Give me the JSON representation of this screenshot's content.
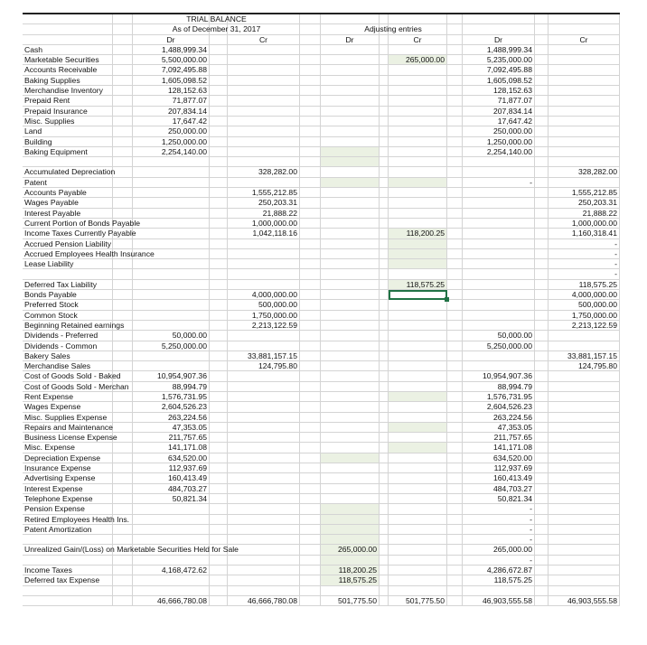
{
  "header": {
    "title": "TRIAL BALANCE",
    "subtitle": "As of December 31, 2017",
    "adjusting_label": "Adjusting entries",
    "dr": "Dr",
    "cr": "Cr"
  },
  "colors": {
    "highlight": "#ebf1e3",
    "selection": "#217346"
  },
  "rows": [
    [
      "Cash",
      "1,488,999.34",
      "",
      "",
      "",
      "1,488,999.34",
      ""
    ],
    [
      "Marketable Securities",
      "5,500,000.00",
      "",
      "",
      "265,000.00",
      "5,235,000.00",
      ""
    ],
    [
      "Accounts Receivable",
      "7,092,495.88",
      "",
      "",
      "",
      "7,092,495.88",
      ""
    ],
    [
      "Baking Supplies",
      "1,605,098.52",
      "",
      "",
      "",
      "1,605,098.52",
      ""
    ],
    [
      "Merchandise Inventory",
      "128,152.63",
      "",
      "",
      "",
      "128,152.63",
      ""
    ],
    [
      "Prepaid Rent",
      "71,877.07",
      "",
      "",
      "",
      "71,877.07",
      ""
    ],
    [
      "Prepaid Insurance",
      "207,834.14",
      "",
      "",
      "",
      "207,834.14",
      ""
    ],
    [
      "Misc. Supplies",
      "17,647.42",
      "",
      "",
      "",
      "17,647.42",
      ""
    ],
    [
      "Land",
      "250,000.00",
      "",
      "",
      "",
      "250,000.00",
      ""
    ],
    [
      "Building",
      "1,250,000.00",
      "",
      "",
      "",
      "1,250,000.00",
      ""
    ],
    [
      "Baking Equipment",
      "2,254,140.00",
      "",
      "",
      "",
      "2,254,140.00",
      ""
    ],
    [
      "",
      "",
      "",
      "",
      "",
      "",
      ""
    ],
    [
      "Accumulated Depreciation",
      "",
      "328,282.00",
      "",
      "",
      "",
      "328,282.00"
    ],
    [
      "Patent",
      "",
      "",
      "",
      "",
      "-",
      ""
    ],
    [
      "Accounts Payable",
      "",
      "1,555,212.85",
      "",
      "",
      "",
      "1,555,212.85"
    ],
    [
      "Wages Payable",
      "",
      "250,203.31",
      "",
      "",
      "",
      "250,203.31"
    ],
    [
      "Interest Payable",
      "",
      "21,888.22",
      "",
      "",
      "",
      "21,888.22"
    ],
    [
      "Current Portion of Bonds Payable",
      "",
      "1,000,000.00",
      "",
      "",
      "",
      "1,000,000.00"
    ],
    [
      "Income Taxes Currently Payable",
      "",
      "1,042,118.16",
      "",
      "118,200.25",
      "",
      "1,160,318.41"
    ],
    [
      "Accrued Pension Liability",
      "",
      "",
      "",
      "",
      "",
      "-"
    ],
    [
      "Accrued Employees Health Insurance",
      "",
      "",
      "",
      "",
      "",
      "-"
    ],
    [
      "Lease Liability",
      "",
      "",
      "",
      "",
      "",
      "-"
    ],
    [
      "",
      "",
      "",
      "",
      "",
      "",
      "-"
    ],
    [
      "Deferred Tax Liability",
      "",
      "",
      "",
      "118,575.25",
      "",
      "118,575.25"
    ],
    [
      "Bonds Payable",
      "",
      "4,000,000.00",
      "",
      "",
      "",
      "4,000,000.00"
    ],
    [
      "Preferred Stock",
      "",
      "500,000.00",
      "",
      "",
      "",
      "500,000.00"
    ],
    [
      "Common Stock",
      "",
      "1,750,000.00",
      "",
      "",
      "",
      "1,750,000.00"
    ],
    [
      "Beginning Retained earnings",
      "",
      "2,213,122.59",
      "",
      "",
      "",
      "2,213,122.59"
    ],
    [
      "Dividends - Preferred",
      "50,000.00",
      "",
      "",
      "",
      "50,000.00",
      ""
    ],
    [
      "Dividends - Common",
      "5,250,000.00",
      "",
      "",
      "",
      "5,250,000.00",
      ""
    ],
    [
      "Bakery Sales",
      "",
      "33,881,157.15",
      "",
      "",
      "",
      "33,881,157.15"
    ],
    [
      "Merchandise Sales",
      "",
      "124,795.80",
      "",
      "",
      "",
      "124,795.80"
    ],
    [
      "Cost of Goods Sold - Baked",
      "10,954,907.36",
      "",
      "",
      "",
      "10,954,907.36",
      ""
    ],
    [
      "Cost of Goods Sold - Merchan",
      "88,994.79",
      "",
      "",
      "",
      "88,994.79",
      ""
    ],
    [
      "Rent Expense",
      "1,576,731.95",
      "",
      "",
      "",
      "1,576,731.95",
      ""
    ],
    [
      "Wages Expense",
      "2,604,526.23",
      "",
      "",
      "",
      "2,604,526.23",
      ""
    ],
    [
      "Misc. Supplies Expense",
      "263,224.56",
      "",
      "",
      "",
      "263,224.56",
      ""
    ],
    [
      "Repairs and Maintenance",
      "47,353.05",
      "",
      "",
      "",
      "47,353.05",
      ""
    ],
    [
      "Business License Expense",
      "211,757.65",
      "",
      "",
      "",
      "211,757.65",
      ""
    ],
    [
      "Misc. Expense",
      "141,171.08",
      "",
      "",
      "",
      "141,171.08",
      ""
    ],
    [
      "Depreciation Expense",
      "634,520.00",
      "",
      "",
      "",
      "634,520.00",
      ""
    ],
    [
      "Insurance Expense",
      "112,937.69",
      "",
      "",
      "",
      "112,937.69",
      ""
    ],
    [
      "Advertising Expense",
      "160,413.49",
      "",
      "",
      "",
      "160,413.49",
      ""
    ],
    [
      "Interest Expense",
      "484,703.27",
      "",
      "",
      "",
      "484,703.27",
      ""
    ],
    [
      "Telephone Expense",
      "50,821.34",
      "",
      "",
      "",
      "50,821.34",
      ""
    ],
    [
      "Pension Expense",
      "",
      "",
      "",
      "",
      "-",
      ""
    ],
    [
      "Retired Employees Health Ins.",
      "",
      "",
      "",
      "",
      "-",
      ""
    ],
    [
      "Patent Amortization",
      "",
      "",
      "",
      "",
      "-",
      ""
    ],
    [
      "",
      "",
      "",
      "",
      "",
      "-",
      ""
    ],
    [
      "Unrealized Gain/(Loss) on Marketable Securities Held for Sale",
      "",
      "",
      "265,000.00",
      "",
      "265,000.00",
      ""
    ],
    [
      "",
      "",
      "",
      "",
      "",
      "-",
      ""
    ],
    [
      "Income Taxes",
      "4,168,472.62",
      "",
      "118,200.25",
      "",
      "4,286,672.87",
      ""
    ],
    [
      "Deferred tax Expense",
      "",
      "",
      "118,575.25",
      "",
      "118,575.25",
      ""
    ],
    [
      "",
      "",
      "",
      "",
      "",
      "",
      ""
    ],
    [
      "",
      "46,666,780.08",
      "46,666,780.08",
      "501,775.50",
      "501,775.50",
      "46,903,555.58",
      "46,903,555.58"
    ]
  ]
}
